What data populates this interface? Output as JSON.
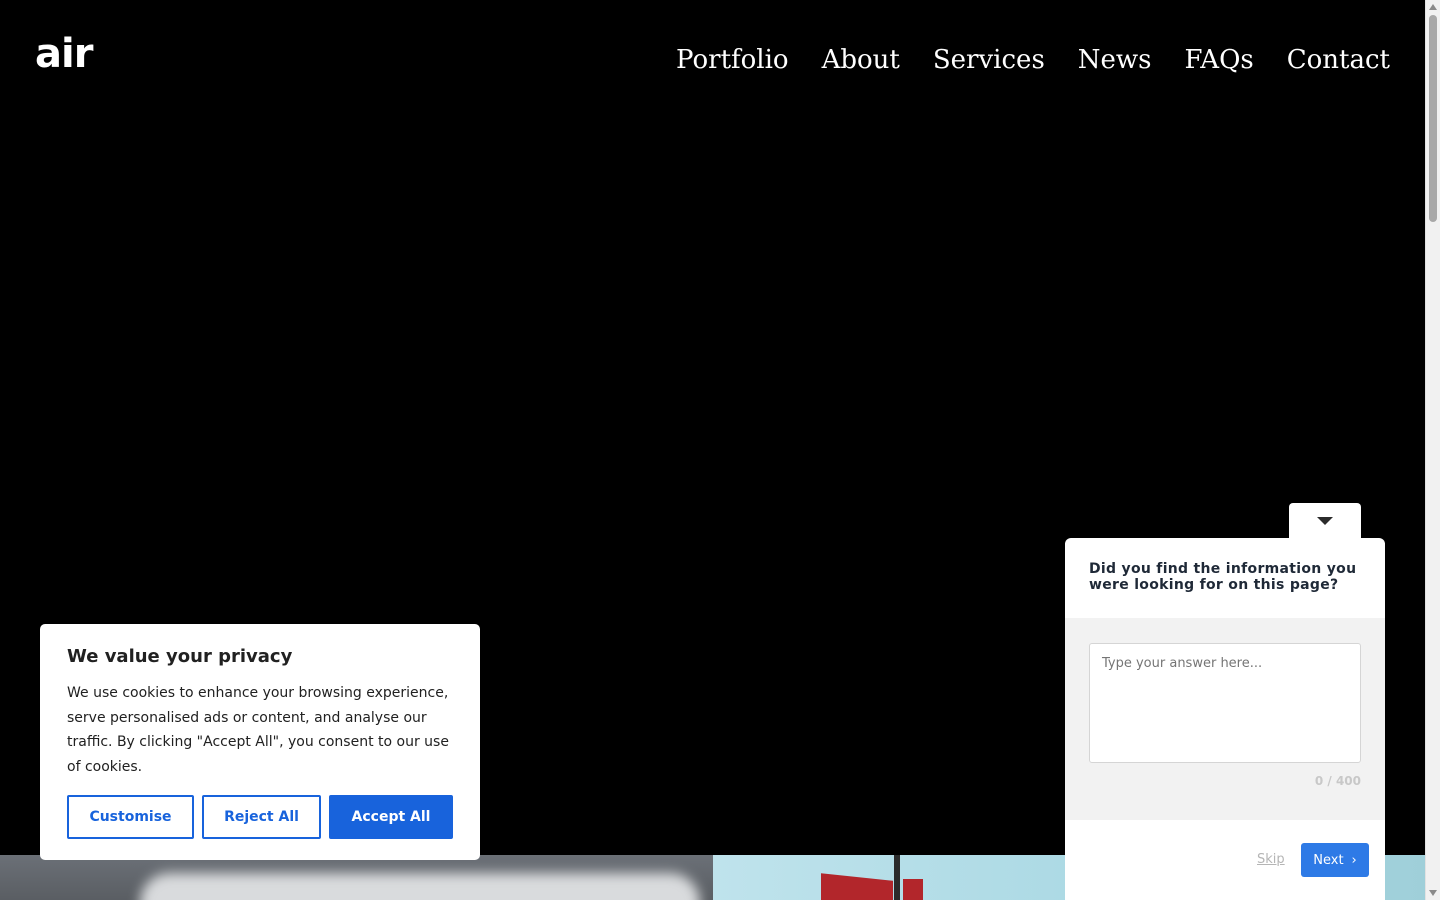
{
  "header": {
    "logo": "air",
    "nav": [
      "Portfolio",
      "About",
      "Services",
      "News",
      "FAQs",
      "Contact"
    ]
  },
  "cookie_banner": {
    "title": "We value your privacy",
    "body": "We use cookies to enhance your browsing experience, serve personalised ads or content, and analyse our traffic. By clicking \"Accept All\", you consent to our use of cookies.",
    "buttons": {
      "customise": "Customise",
      "reject": "Reject All",
      "accept": "Accept All"
    }
  },
  "survey": {
    "question": "Did you find the information you were looking for on this page?",
    "placeholder": "Type your answer here...",
    "counter": "0 / 400",
    "skip": "Skip",
    "next": "Next",
    "toggle_icon": "chevron-down-icon"
  },
  "colors": {
    "primary_blue": "#1863dc",
    "survey_next": "#2e7ae6",
    "background": "#000000"
  }
}
